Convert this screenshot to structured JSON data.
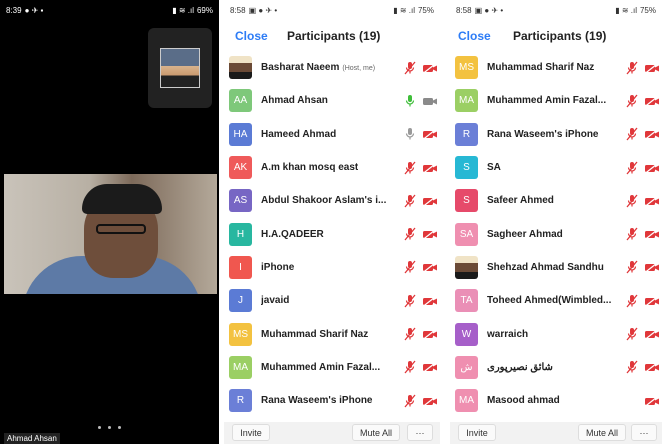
{
  "screen1": {
    "status_time": "8:39",
    "status_battery": "69%",
    "thumbnail": "self-view",
    "speaker_name": "Ahmad Ahsan"
  },
  "screen2": {
    "status_time": "8:58",
    "status_battery": "75%",
    "close_label": "Close",
    "title": "Participants (19)",
    "participants": [
      {
        "initials": "",
        "name": "Basharat Naeem",
        "tag": "(Host, me)",
        "color": "",
        "mic": "muted",
        "cam": "off"
      },
      {
        "initials": "AA",
        "name": "Ahmad Ahsan",
        "tag": "",
        "color": "#7ec87a",
        "mic": "active",
        "cam": "on"
      },
      {
        "initials": "HA",
        "name": "Hameed Ahmad",
        "tag": "",
        "color": "#5b7bd5",
        "mic": "idle",
        "cam": "off"
      },
      {
        "initials": "AK",
        "name": "A.m khan  mosq east",
        "tag": "",
        "color": "#ef5a5a",
        "mic": "muted",
        "cam": "off"
      },
      {
        "initials": "AS",
        "name": "Abdul Shakoor Aslam's i...",
        "tag": "",
        "color": "#7766c4",
        "mic": "muted",
        "cam": "off"
      },
      {
        "initials": "H",
        "name": "H.A.QADEER",
        "tag": "",
        "color": "#28b7a0",
        "mic": "muted",
        "cam": "off"
      },
      {
        "initials": "I",
        "name": "iPhone",
        "tag": "",
        "color": "#f0574f",
        "mic": "muted",
        "cam": "off"
      },
      {
        "initials": "J",
        "name": "javaid",
        "tag": "",
        "color": "#5b7bd5",
        "mic": "muted",
        "cam": "off"
      },
      {
        "initials": "MS",
        "name": "Muhammad Sharif Naz",
        "tag": "",
        "color": "#f3c240",
        "mic": "muted",
        "cam": "off"
      },
      {
        "initials": "MA",
        "name": "Muhammed Amin Fazal...",
        "tag": "",
        "color": "#9bcf64",
        "mic": "muted",
        "cam": "off"
      },
      {
        "initials": "R",
        "name": "Rana Waseem's iPhone",
        "tag": "",
        "color": "#6b7fd7",
        "mic": "muted",
        "cam": "off"
      }
    ],
    "invite_label": "Invite",
    "mute_all_label": "Mute All",
    "more_label": "···"
  },
  "screen3": {
    "status_time": "8:58",
    "status_battery": "75%",
    "close_label": "Close",
    "title": "Participants (19)",
    "participants": [
      {
        "initials": "MS",
        "name": "Muhammad Sharif Naz",
        "tag": "",
        "color": "#f3c240",
        "mic": "muted",
        "cam": "off"
      },
      {
        "initials": "MA",
        "name": "Muhammed Amin Fazal...",
        "tag": "",
        "color": "#9bcf64",
        "mic": "muted",
        "cam": "off"
      },
      {
        "initials": "R",
        "name": "Rana Waseem's iPhone",
        "tag": "",
        "color": "#6b7fd7",
        "mic": "muted",
        "cam": "off"
      },
      {
        "initials": "S",
        "name": "SA",
        "tag": "",
        "color": "#27b8d4",
        "mic": "muted",
        "cam": "off"
      },
      {
        "initials": "S",
        "name": "Safeer Ahmed",
        "tag": "",
        "color": "#e64a6a",
        "mic": "muted",
        "cam": "off"
      },
      {
        "initials": "SA",
        "name": "Sagheer Ahmad",
        "tag": "",
        "color": "#ef8fb0",
        "mic": "muted",
        "cam": "off"
      },
      {
        "initials": "",
        "name": "Shehzad Ahmad Sandhu",
        "tag": "",
        "color": "",
        "mic": "muted",
        "cam": "off"
      },
      {
        "initials": "TA",
        "name": "Toheed Ahmed(Wimbled...",
        "tag": "",
        "color": "#ea8fb6",
        "mic": "muted",
        "cam": "off"
      },
      {
        "initials": "W",
        "name": "warraich",
        "tag": "",
        "color": "#a65fc9",
        "mic": "muted",
        "cam": "off"
      },
      {
        "initials": "ش",
        "name": "شائق نصیرپوری",
        "tag": "",
        "color": "#ef8fb0",
        "mic": "muted",
        "cam": "off"
      },
      {
        "initials": "MA",
        "name": "Masood ahmad",
        "tag": "",
        "color": "#ef8fb0",
        "mic": "none",
        "cam": "off"
      }
    ],
    "invite_label": "Invite",
    "mute_all_label": "Mute All",
    "more_label": "···"
  }
}
